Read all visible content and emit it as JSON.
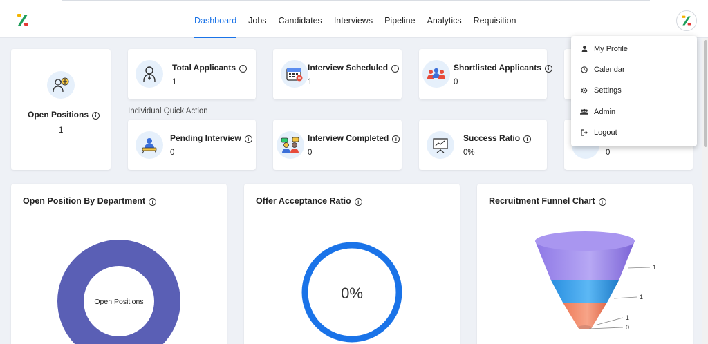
{
  "nav": {
    "items": [
      "Dashboard",
      "Jobs",
      "Candidates",
      "Interviews",
      "Pipeline",
      "Analytics",
      "Requisition"
    ],
    "active": "Dashboard"
  },
  "open_positions": {
    "label": "Open Positions",
    "value": "1"
  },
  "stats_top": [
    {
      "label": "Total Applicants",
      "value": "1",
      "icon": "applicant-icon"
    },
    {
      "label": "Interview Scheduled",
      "value": "1",
      "icon": "calendar-icon"
    },
    {
      "label": "Shortlisted Applicants",
      "value": "0",
      "icon": "shortlist-icon"
    }
  ],
  "quick_action_label": "Individual Quick Action",
  "stats_bottom": [
    {
      "label": "Pending Interview",
      "value": "0",
      "icon": "meeting-icon"
    },
    {
      "label": "Interview Completed",
      "value": "0",
      "icon": "interview-icon"
    },
    {
      "label": "Success Ratio",
      "value": "0%",
      "icon": "presentation-icon"
    },
    {
      "label": "",
      "value": "0",
      "icon": "partial-icon"
    }
  ],
  "charts": {
    "department": {
      "title": "Open Position By Department",
      "center_label": "Open Positions",
      "color": "#5a5fb5"
    },
    "offer": {
      "title": "Offer Acceptance Ratio",
      "value": "0%",
      "color": "#1a73e8"
    },
    "funnel": {
      "title": "Recruitment Funnel Chart"
    }
  },
  "chart_data": {
    "type": "funnel",
    "title": "Recruitment Funnel Chart",
    "values": [
      1,
      1,
      1,
      0
    ],
    "colors": [
      "#9b8ae8",
      "#3aa0e8",
      "#f28a6a",
      "#b9b9c8"
    ]
  },
  "user_menu": {
    "items": [
      {
        "label": "My Profile",
        "icon": "user-icon"
      },
      {
        "label": "Calendar",
        "icon": "clock-icon"
      },
      {
        "label": "Settings",
        "icon": "gear-icon"
      },
      {
        "label": "Admin",
        "icon": "users-icon"
      },
      {
        "label": "Logout",
        "icon": "logout-icon"
      }
    ]
  },
  "colors": {
    "accent": "#1a73e8",
    "background": "#eef1f6"
  }
}
